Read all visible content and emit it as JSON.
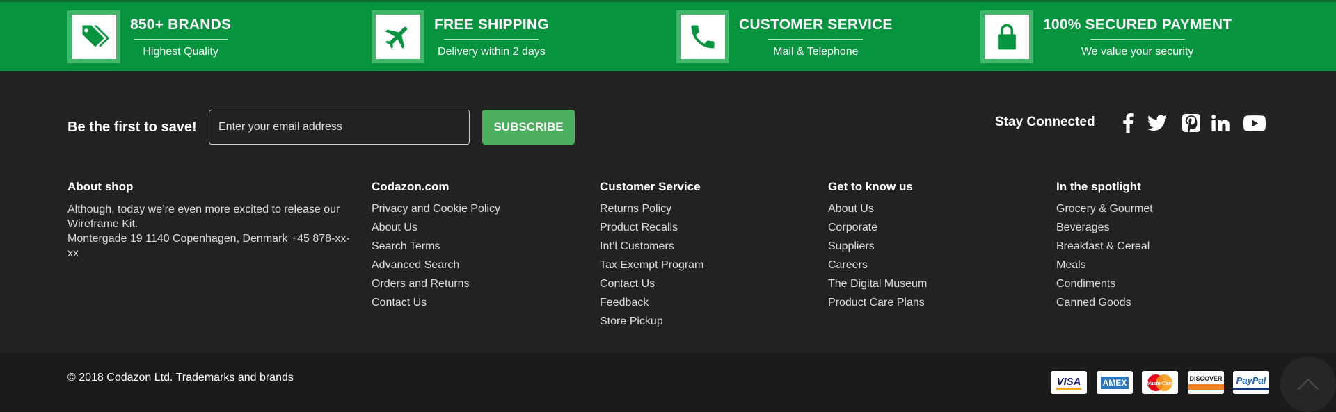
{
  "features": [
    {
      "title": "850+ BRANDS",
      "subtitle": "Highest Quality",
      "icon": "tag-icon"
    },
    {
      "title": "FREE SHIPPING",
      "subtitle": "Delivery within 2 days",
      "icon": "airplane-icon"
    },
    {
      "title": "CUSTOMER SERVICE",
      "subtitle": "Mail & Telephone",
      "icon": "phone-icon"
    },
    {
      "title": "100% SECURED PAYMENT",
      "subtitle": "We value your security",
      "icon": "lock-icon"
    }
  ],
  "newsletter": {
    "label": "Be the first to save!",
    "placeholder": "Enter your email address",
    "button": "SUBSCRIBE"
  },
  "social": {
    "label": "Stay Connected",
    "icons": [
      "facebook-icon",
      "twitter-icon",
      "pinterest-icon",
      "linkedin-icon",
      "youtube-icon"
    ]
  },
  "columns": {
    "about": {
      "title": "About shop",
      "line1": "Although, today we’re even more excited to release our Wireframe Kit.",
      "line2": "Montergade 19 1140 Copenhagen, Denmark +45 878-xx-xx"
    },
    "codazon": {
      "title": "Codazon.com",
      "links": [
        "Privacy and Cookie Policy",
        "About Us",
        "Search Terms",
        "Advanced Search",
        "Orders and Returns",
        "Contact Us"
      ]
    },
    "service": {
      "title": "Customer Service",
      "links": [
        "Returns Policy",
        "Product Recalls",
        "Int’l Customers",
        "Tax Exempt Program",
        "Contact Us",
        "Feedback",
        "Store Pickup"
      ]
    },
    "know": {
      "title": "Get to know us",
      "links": [
        "About Us",
        "Corporate",
        "Suppliers",
        "Careers",
        "The Digital Museum",
        "Product Care Plans"
      ]
    },
    "spotlight": {
      "title": "In the spotlight",
      "links": [
        "Grocery & Gourmet",
        "Beverages",
        "Breakfast & Cereal",
        "Meals",
        "Condiments",
        "Canned Goods"
      ]
    }
  },
  "bottom": {
    "copyright": "© 2018 Codazon Ltd. Trademarks and brands",
    "payments": [
      "VISA",
      "AMEX",
      "MasterCard",
      "DISCOVER",
      "PayPal"
    ]
  },
  "colors": {
    "brand_green": "#07943e",
    "subscribe_green": "#4caf5e",
    "footer_bg": "#222222"
  }
}
